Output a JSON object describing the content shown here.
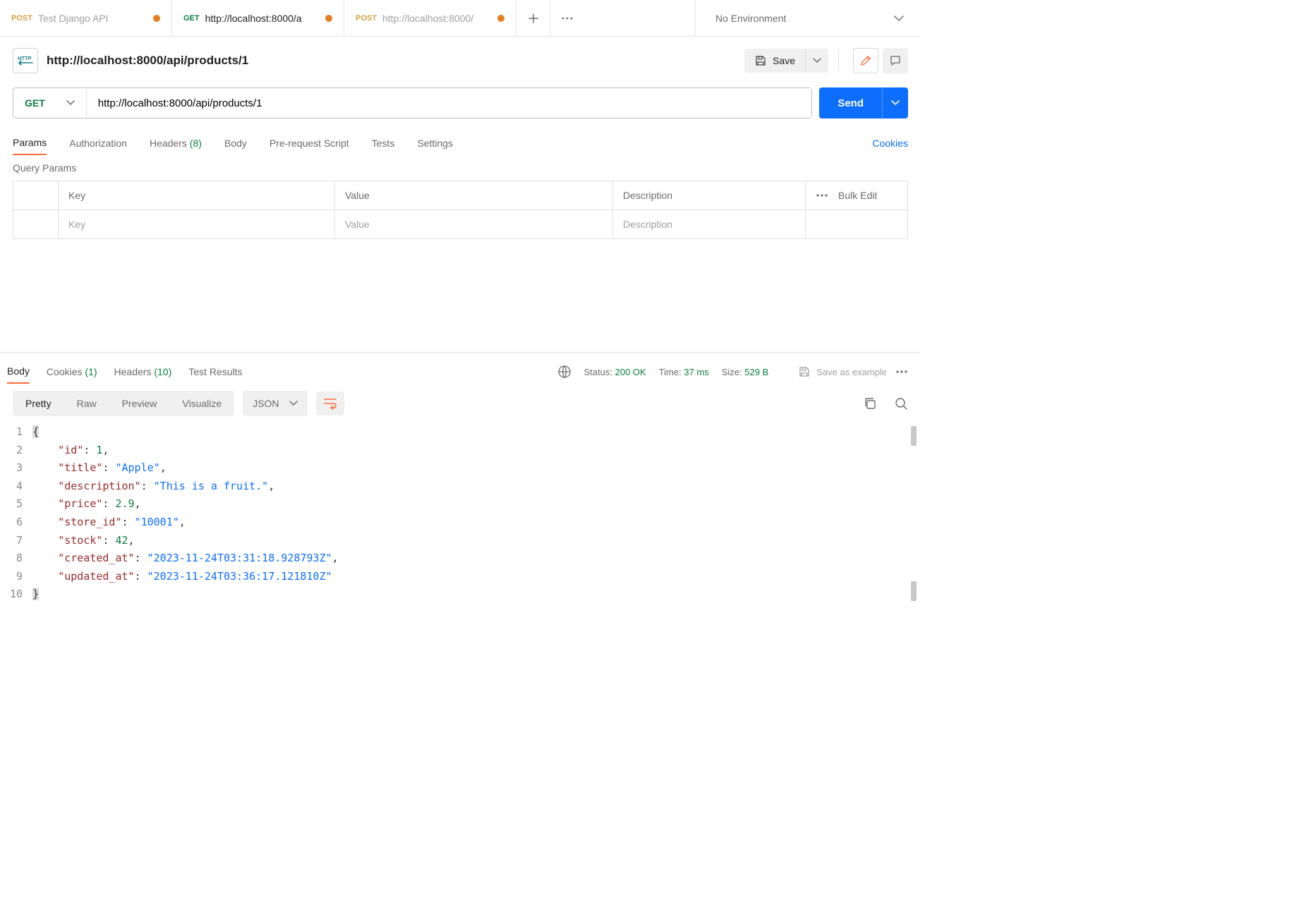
{
  "tabs": [
    {
      "method": "POST",
      "title": "Test Django API",
      "unsaved": true,
      "active": false
    },
    {
      "method": "GET",
      "title": "http://localhost:8000/a",
      "unsaved": true,
      "active": true
    },
    {
      "method": "POST",
      "title": "http://localhost:8000/",
      "unsaved": true,
      "active": false
    }
  ],
  "env": {
    "label": "No Environment"
  },
  "request": {
    "name": "http://localhost:8000/api/products/1",
    "method": "GET",
    "url": "http://localhost:8000/api/products/1",
    "save_label": "Save",
    "send_label": "Send"
  },
  "req_tabs": {
    "params": "Params",
    "authorization": "Authorization",
    "headers": "Headers",
    "headers_count": "(8)",
    "body": "Body",
    "prerequest": "Pre-request Script",
    "tests": "Tests",
    "settings": "Settings",
    "cookies": "Cookies"
  },
  "params_section": {
    "title": "Query Params",
    "columns": {
      "key": "Key",
      "value": "Value",
      "description": "Description",
      "bulk": "Bulk Edit"
    },
    "placeholders": {
      "key": "Key",
      "value": "Value",
      "description": "Description"
    }
  },
  "response": {
    "tabs": {
      "body": "Body",
      "cookies": "Cookies",
      "cookies_count": "(1)",
      "headers": "Headers",
      "headers_count": "(10)",
      "test_results": "Test Results"
    },
    "meta": {
      "status_label": "Status:",
      "status_value": "200 OK",
      "time_label": "Time:",
      "time_value": "37 ms",
      "size_label": "Size:",
      "size_value": "529 B",
      "save_example": "Save as example"
    },
    "view": {
      "pretty": "Pretty",
      "raw": "Raw",
      "preview": "Preview",
      "visualize": "Visualize",
      "format": "JSON"
    },
    "body_lines": [
      [
        {
          "t": "brace",
          "v": "{"
        }
      ],
      [
        {
          "t": "indent"
        },
        {
          "t": "key",
          "v": "\"id\""
        },
        {
          "t": "punc",
          "v": ": "
        },
        {
          "t": "num",
          "v": "1"
        },
        {
          "t": "punc",
          "v": ","
        }
      ],
      [
        {
          "t": "indent"
        },
        {
          "t": "key",
          "v": "\"title\""
        },
        {
          "t": "punc",
          "v": ": "
        },
        {
          "t": "str",
          "v": "\"Apple\""
        },
        {
          "t": "punc",
          "v": ","
        }
      ],
      [
        {
          "t": "indent"
        },
        {
          "t": "key",
          "v": "\"description\""
        },
        {
          "t": "punc",
          "v": ": "
        },
        {
          "t": "str",
          "v": "\"This is a fruit.\""
        },
        {
          "t": "punc",
          "v": ","
        }
      ],
      [
        {
          "t": "indent"
        },
        {
          "t": "key",
          "v": "\"price\""
        },
        {
          "t": "punc",
          "v": ": "
        },
        {
          "t": "num",
          "v": "2.9"
        },
        {
          "t": "punc",
          "v": ","
        }
      ],
      [
        {
          "t": "indent"
        },
        {
          "t": "key",
          "v": "\"store_id\""
        },
        {
          "t": "punc",
          "v": ": "
        },
        {
          "t": "str",
          "v": "\"10001\""
        },
        {
          "t": "punc",
          "v": ","
        }
      ],
      [
        {
          "t": "indent"
        },
        {
          "t": "key",
          "v": "\"stock\""
        },
        {
          "t": "punc",
          "v": ": "
        },
        {
          "t": "num",
          "v": "42"
        },
        {
          "t": "punc",
          "v": ","
        }
      ],
      [
        {
          "t": "indent"
        },
        {
          "t": "key",
          "v": "\"created_at\""
        },
        {
          "t": "punc",
          "v": ": "
        },
        {
          "t": "str",
          "v": "\"2023-11-24T03:31:18.928793Z\""
        },
        {
          "t": "punc",
          "v": ","
        }
      ],
      [
        {
          "t": "indent"
        },
        {
          "t": "key",
          "v": "\"updated_at\""
        },
        {
          "t": "punc",
          "v": ": "
        },
        {
          "t": "str",
          "v": "\"2023-11-24T03:36:17.121810Z\""
        }
      ],
      [
        {
          "t": "brace",
          "v": "}"
        }
      ]
    ]
  }
}
